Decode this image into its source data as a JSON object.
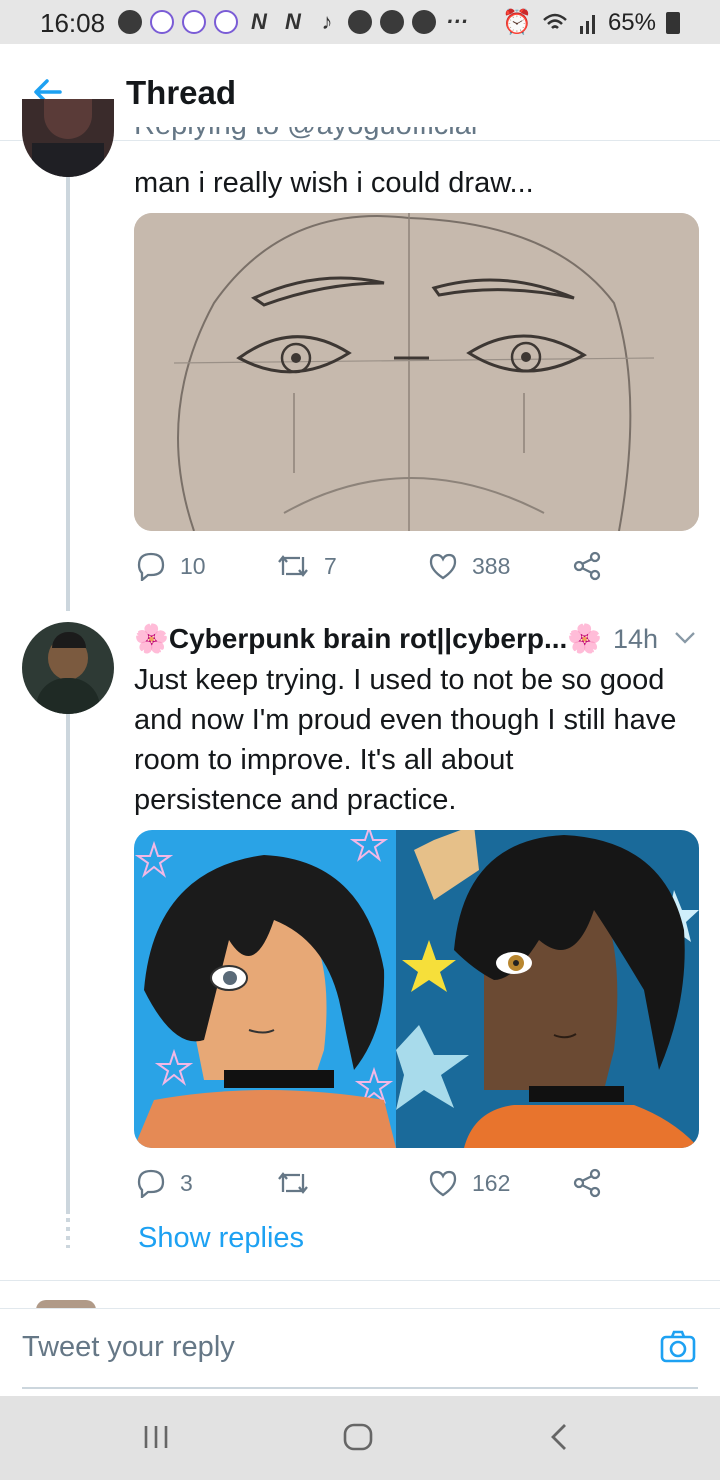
{
  "status_bar": {
    "time": "16:08",
    "battery": "65%"
  },
  "header": {
    "title": "Thread"
  },
  "tweet1": {
    "replying_to": "Replying to @ayoguofficial",
    "text": "man i really wish i could draw...",
    "replies": "10",
    "retweets": "7",
    "likes": "388"
  },
  "tweet2": {
    "name": "🌸Cyberpunk brain rot||cyberp...🌸",
    "time": "14h",
    "text_lines": [
      "Just keep trying. I used to not be so good",
      "and now I'm proud even though I still have",
      "room to improve. It's all about",
      "persistence and practice."
    ],
    "replies": "3",
    "retweets": "",
    "likes": "162"
  },
  "show_replies": "Show replies",
  "reply_bar": {
    "placeholder": "Tweet your reply"
  },
  "colors": {
    "accent": "#1da1f2",
    "muted": "#657786"
  }
}
